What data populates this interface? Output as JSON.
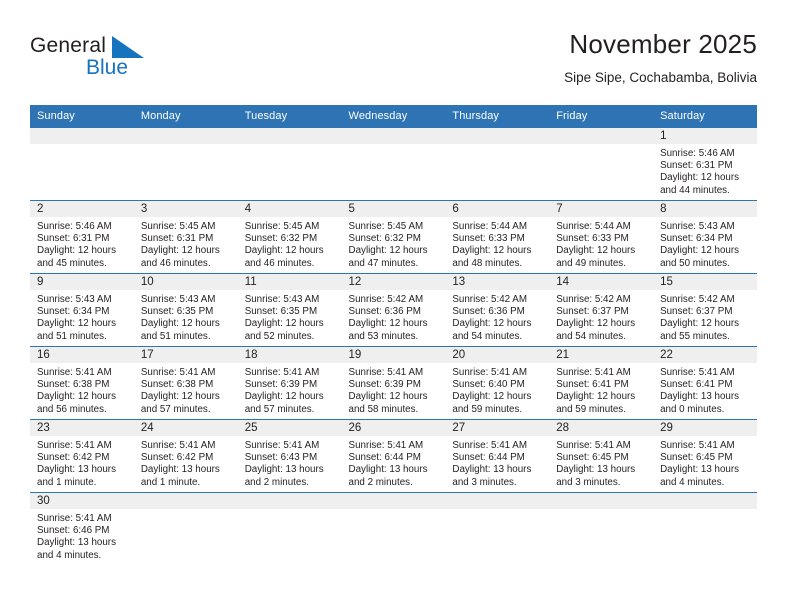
{
  "brand": {
    "name_part1": "General",
    "name_part2": "Blue",
    "flag_icon": "blue-triangle-flag-icon",
    "colors": {
      "dark": "#231f20",
      "blue": "#1574bd"
    }
  },
  "header": {
    "title": "November 2025",
    "subtitle": "Sipe Sipe, Cochabamba, Bolivia"
  },
  "theme": {
    "header_blue": "#2e74b5",
    "daynum_band": "#efefef",
    "text": "#231f20"
  },
  "calendar": {
    "weekday_headers": [
      "Sunday",
      "Monday",
      "Tuesday",
      "Wednesday",
      "Thursday",
      "Friday",
      "Saturday"
    ],
    "weeks": [
      [
        {
          "day": "",
          "sunrise": "",
          "sunset": "",
          "daylight1": "",
          "daylight2": ""
        },
        {
          "day": "",
          "sunrise": "",
          "sunset": "",
          "daylight1": "",
          "daylight2": ""
        },
        {
          "day": "",
          "sunrise": "",
          "sunset": "",
          "daylight1": "",
          "daylight2": ""
        },
        {
          "day": "",
          "sunrise": "",
          "sunset": "",
          "daylight1": "",
          "daylight2": ""
        },
        {
          "day": "",
          "sunrise": "",
          "sunset": "",
          "daylight1": "",
          "daylight2": ""
        },
        {
          "day": "",
          "sunrise": "",
          "sunset": "",
          "daylight1": "",
          "daylight2": ""
        },
        {
          "day": "1",
          "sunrise": "Sunrise: 5:46 AM",
          "sunset": "Sunset: 6:31 PM",
          "daylight1": "Daylight: 12 hours",
          "daylight2": "and 44 minutes."
        }
      ],
      [
        {
          "day": "2",
          "sunrise": "Sunrise: 5:46 AM",
          "sunset": "Sunset: 6:31 PM",
          "daylight1": "Daylight: 12 hours",
          "daylight2": "and 45 minutes."
        },
        {
          "day": "3",
          "sunrise": "Sunrise: 5:45 AM",
          "sunset": "Sunset: 6:31 PM",
          "daylight1": "Daylight: 12 hours",
          "daylight2": "and 46 minutes."
        },
        {
          "day": "4",
          "sunrise": "Sunrise: 5:45 AM",
          "sunset": "Sunset: 6:32 PM",
          "daylight1": "Daylight: 12 hours",
          "daylight2": "and 46 minutes."
        },
        {
          "day": "5",
          "sunrise": "Sunrise: 5:45 AM",
          "sunset": "Sunset: 6:32 PM",
          "daylight1": "Daylight: 12 hours",
          "daylight2": "and 47 minutes."
        },
        {
          "day": "6",
          "sunrise": "Sunrise: 5:44 AM",
          "sunset": "Sunset: 6:33 PM",
          "daylight1": "Daylight: 12 hours",
          "daylight2": "and 48 minutes."
        },
        {
          "day": "7",
          "sunrise": "Sunrise: 5:44 AM",
          "sunset": "Sunset: 6:33 PM",
          "daylight1": "Daylight: 12 hours",
          "daylight2": "and 49 minutes."
        },
        {
          "day": "8",
          "sunrise": "Sunrise: 5:43 AM",
          "sunset": "Sunset: 6:34 PM",
          "daylight1": "Daylight: 12 hours",
          "daylight2": "and 50 minutes."
        }
      ],
      [
        {
          "day": "9",
          "sunrise": "Sunrise: 5:43 AM",
          "sunset": "Sunset: 6:34 PM",
          "daylight1": "Daylight: 12 hours",
          "daylight2": "and 51 minutes."
        },
        {
          "day": "10",
          "sunrise": "Sunrise: 5:43 AM",
          "sunset": "Sunset: 6:35 PM",
          "daylight1": "Daylight: 12 hours",
          "daylight2": "and 51 minutes."
        },
        {
          "day": "11",
          "sunrise": "Sunrise: 5:43 AM",
          "sunset": "Sunset: 6:35 PM",
          "daylight1": "Daylight: 12 hours",
          "daylight2": "and 52 minutes."
        },
        {
          "day": "12",
          "sunrise": "Sunrise: 5:42 AM",
          "sunset": "Sunset: 6:36 PM",
          "daylight1": "Daylight: 12 hours",
          "daylight2": "and 53 minutes."
        },
        {
          "day": "13",
          "sunrise": "Sunrise: 5:42 AM",
          "sunset": "Sunset: 6:36 PM",
          "daylight1": "Daylight: 12 hours",
          "daylight2": "and 54 minutes."
        },
        {
          "day": "14",
          "sunrise": "Sunrise: 5:42 AM",
          "sunset": "Sunset: 6:37 PM",
          "daylight1": "Daylight: 12 hours",
          "daylight2": "and 54 minutes."
        },
        {
          "day": "15",
          "sunrise": "Sunrise: 5:42 AM",
          "sunset": "Sunset: 6:37 PM",
          "daylight1": "Daylight: 12 hours",
          "daylight2": "and 55 minutes."
        }
      ],
      [
        {
          "day": "16",
          "sunrise": "Sunrise: 5:41 AM",
          "sunset": "Sunset: 6:38 PM",
          "daylight1": "Daylight: 12 hours",
          "daylight2": "and 56 minutes."
        },
        {
          "day": "17",
          "sunrise": "Sunrise: 5:41 AM",
          "sunset": "Sunset: 6:38 PM",
          "daylight1": "Daylight: 12 hours",
          "daylight2": "and 57 minutes."
        },
        {
          "day": "18",
          "sunrise": "Sunrise: 5:41 AM",
          "sunset": "Sunset: 6:39 PM",
          "daylight1": "Daylight: 12 hours",
          "daylight2": "and 57 minutes."
        },
        {
          "day": "19",
          "sunrise": "Sunrise: 5:41 AM",
          "sunset": "Sunset: 6:39 PM",
          "daylight1": "Daylight: 12 hours",
          "daylight2": "and 58 minutes."
        },
        {
          "day": "20",
          "sunrise": "Sunrise: 5:41 AM",
          "sunset": "Sunset: 6:40 PM",
          "daylight1": "Daylight: 12 hours",
          "daylight2": "and 59 minutes."
        },
        {
          "day": "21",
          "sunrise": "Sunrise: 5:41 AM",
          "sunset": "Sunset: 6:41 PM",
          "daylight1": "Daylight: 12 hours",
          "daylight2": "and 59 minutes."
        },
        {
          "day": "22",
          "sunrise": "Sunrise: 5:41 AM",
          "sunset": "Sunset: 6:41 PM",
          "daylight1": "Daylight: 13 hours",
          "daylight2": "and 0 minutes."
        }
      ],
      [
        {
          "day": "23",
          "sunrise": "Sunrise: 5:41 AM",
          "sunset": "Sunset: 6:42 PM",
          "daylight1": "Daylight: 13 hours",
          "daylight2": "and 1 minute."
        },
        {
          "day": "24",
          "sunrise": "Sunrise: 5:41 AM",
          "sunset": "Sunset: 6:42 PM",
          "daylight1": "Daylight: 13 hours",
          "daylight2": "and 1 minute."
        },
        {
          "day": "25",
          "sunrise": "Sunrise: 5:41 AM",
          "sunset": "Sunset: 6:43 PM",
          "daylight1": "Daylight: 13 hours",
          "daylight2": "and 2 minutes."
        },
        {
          "day": "26",
          "sunrise": "Sunrise: 5:41 AM",
          "sunset": "Sunset: 6:44 PM",
          "daylight1": "Daylight: 13 hours",
          "daylight2": "and 2 minutes."
        },
        {
          "day": "27",
          "sunrise": "Sunrise: 5:41 AM",
          "sunset": "Sunset: 6:44 PM",
          "daylight1": "Daylight: 13 hours",
          "daylight2": "and 3 minutes."
        },
        {
          "day": "28",
          "sunrise": "Sunrise: 5:41 AM",
          "sunset": "Sunset: 6:45 PM",
          "daylight1": "Daylight: 13 hours",
          "daylight2": "and 3 minutes."
        },
        {
          "day": "29",
          "sunrise": "Sunrise: 5:41 AM",
          "sunset": "Sunset: 6:45 PM",
          "daylight1": "Daylight: 13 hours",
          "daylight2": "and 4 minutes."
        }
      ],
      [
        {
          "day": "30",
          "sunrise": "Sunrise: 5:41 AM",
          "sunset": "Sunset: 6:46 PM",
          "daylight1": "Daylight: 13 hours",
          "daylight2": "and 4 minutes."
        },
        {
          "day": "",
          "sunrise": "",
          "sunset": "",
          "daylight1": "",
          "daylight2": ""
        },
        {
          "day": "",
          "sunrise": "",
          "sunset": "",
          "daylight1": "",
          "daylight2": ""
        },
        {
          "day": "",
          "sunrise": "",
          "sunset": "",
          "daylight1": "",
          "daylight2": ""
        },
        {
          "day": "",
          "sunrise": "",
          "sunset": "",
          "daylight1": "",
          "daylight2": ""
        },
        {
          "day": "",
          "sunrise": "",
          "sunset": "",
          "daylight1": "",
          "daylight2": ""
        },
        {
          "day": "",
          "sunrise": "",
          "sunset": "",
          "daylight1": "",
          "daylight2": ""
        }
      ]
    ]
  }
}
